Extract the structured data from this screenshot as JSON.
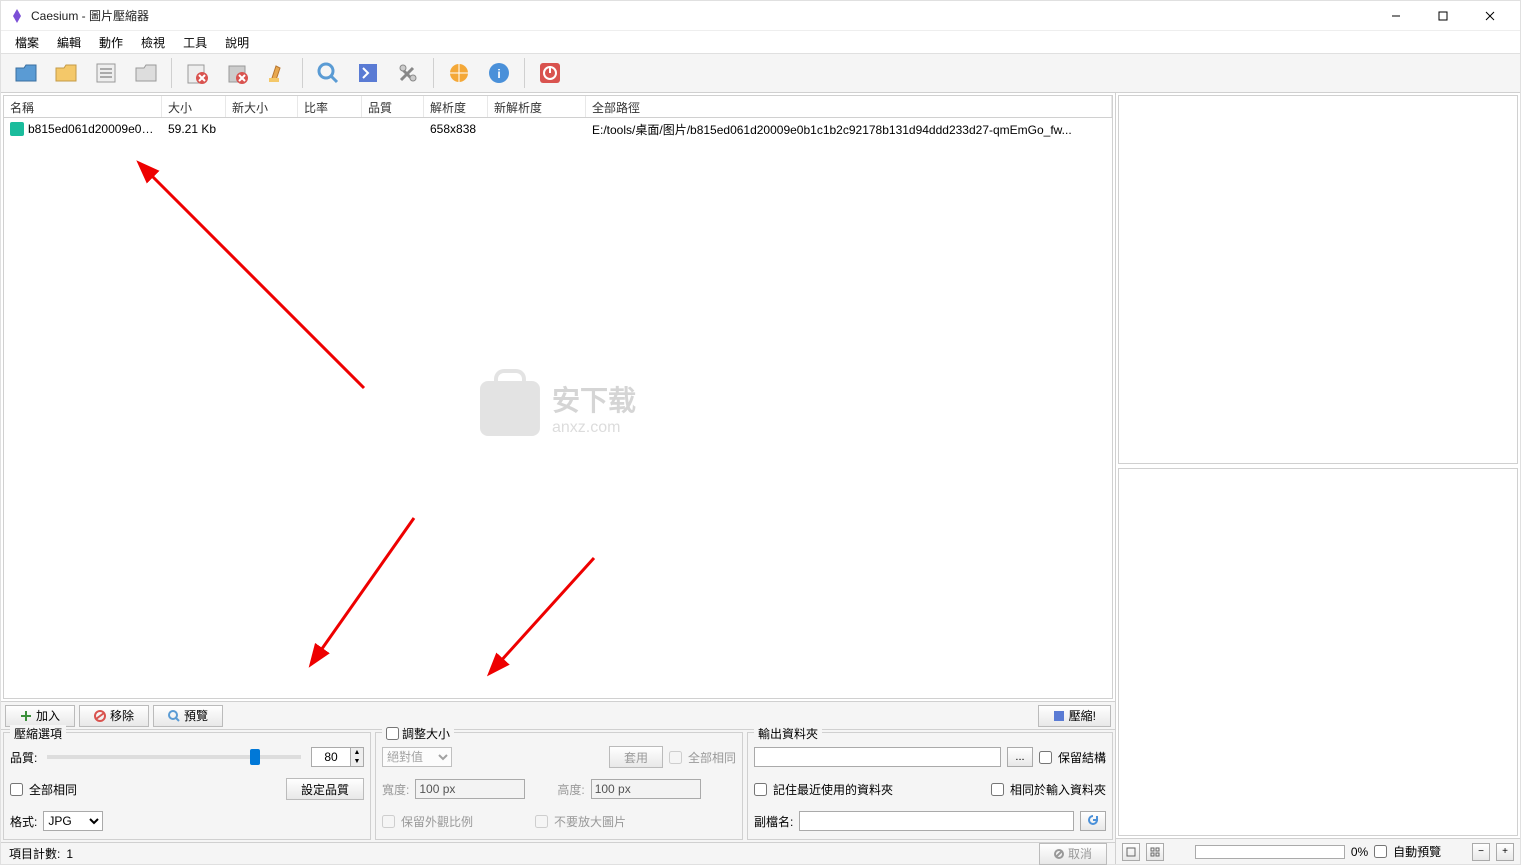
{
  "window": {
    "title": "Caesium - 圖片壓縮器"
  },
  "menu": {
    "file": "檔案",
    "edit": "編輯",
    "action": "動作",
    "view": "檢視",
    "tools": "工具",
    "help": "說明"
  },
  "columns": {
    "name": "名稱",
    "size": "大小",
    "newsize": "新大小",
    "ratio": "比率",
    "quality": "品質",
    "res": "解析度",
    "newres": "新解析度",
    "path": "全部路徑"
  },
  "files": [
    {
      "name": "b815ed061d20009e0b...",
      "size": "59.21 Kb",
      "newsize": "",
      "ratio": "",
      "quality": "",
      "res": "658x838",
      "newres": "",
      "path": "E:/tools/桌面/图片/b815ed061d20009e0b1c1b2c92178b131d94ddd233d27-qmEmGo_fw..."
    }
  ],
  "watermark": {
    "cn": "安下载",
    "en": "anxz.com"
  },
  "actions": {
    "add": "加入",
    "remove": "移除",
    "preview": "預覽",
    "compress": "壓縮!"
  },
  "compress": {
    "group_title": "壓縮選項",
    "quality_label": "品質:",
    "quality_value": "80",
    "same_all": "全部相同",
    "set_quality": "設定品質",
    "format_label": "格式:",
    "format_value": "JPG"
  },
  "resize": {
    "group_title": "調整大小",
    "mode_label": "絕對值",
    "apply": "套用",
    "same_all": "全部相同",
    "width_label": "寬度:",
    "height_label": "高度:",
    "width_value": "100 px",
    "height_value": "100 px",
    "keep_aspect": "保留外觀比例",
    "no_enlarge": "不要放大圖片"
  },
  "output": {
    "group_title": "輸出資料夾",
    "browse": "...",
    "keep_structure": "保留結構",
    "remember": "記住最近使用的資料夾",
    "same_as_input": "相同於輸入資料夾",
    "suffix_label": "副檔名:",
    "path_value": "",
    "suffix_value": ""
  },
  "status": {
    "count_label": "項目計數:",
    "count_value": "1",
    "cancel": "取消",
    "percent": "0%"
  },
  "preview": {
    "auto": "自動預覽"
  }
}
